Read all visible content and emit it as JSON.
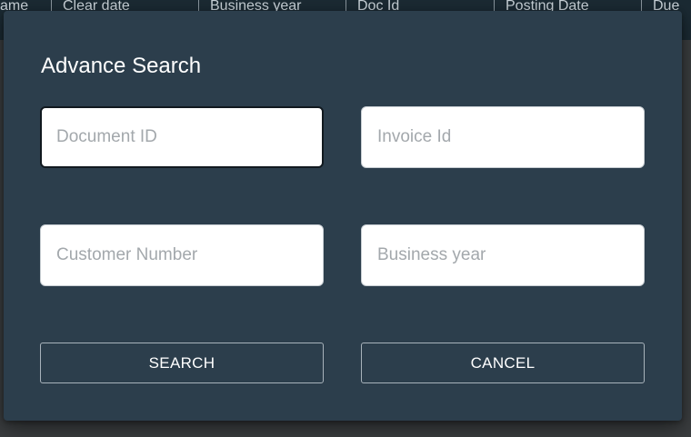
{
  "background_table": {
    "columns": [
      "ame",
      "Clear date",
      "Business year",
      "Doc Id",
      "Posting Date",
      "Due"
    ]
  },
  "dialog": {
    "title": "Advance Search",
    "fields": {
      "document_id": {
        "value": "",
        "placeholder": "Document ID"
      },
      "invoice_id": {
        "value": "",
        "placeholder": "Invoice Id"
      },
      "customer_number": {
        "value": "",
        "placeholder": "Customer Number"
      },
      "business_year": {
        "value": "",
        "placeholder": "Business year"
      }
    },
    "buttons": {
      "search_label": "SEARCH",
      "cancel_label": "CANCEL"
    }
  },
  "colors": {
    "dialog_background": "#2c3e4c",
    "page_background": "#3a3d3f",
    "header_background": "#1b2a33",
    "button_border": "#a8b3bb",
    "placeholder": "#a3a8ac"
  }
}
